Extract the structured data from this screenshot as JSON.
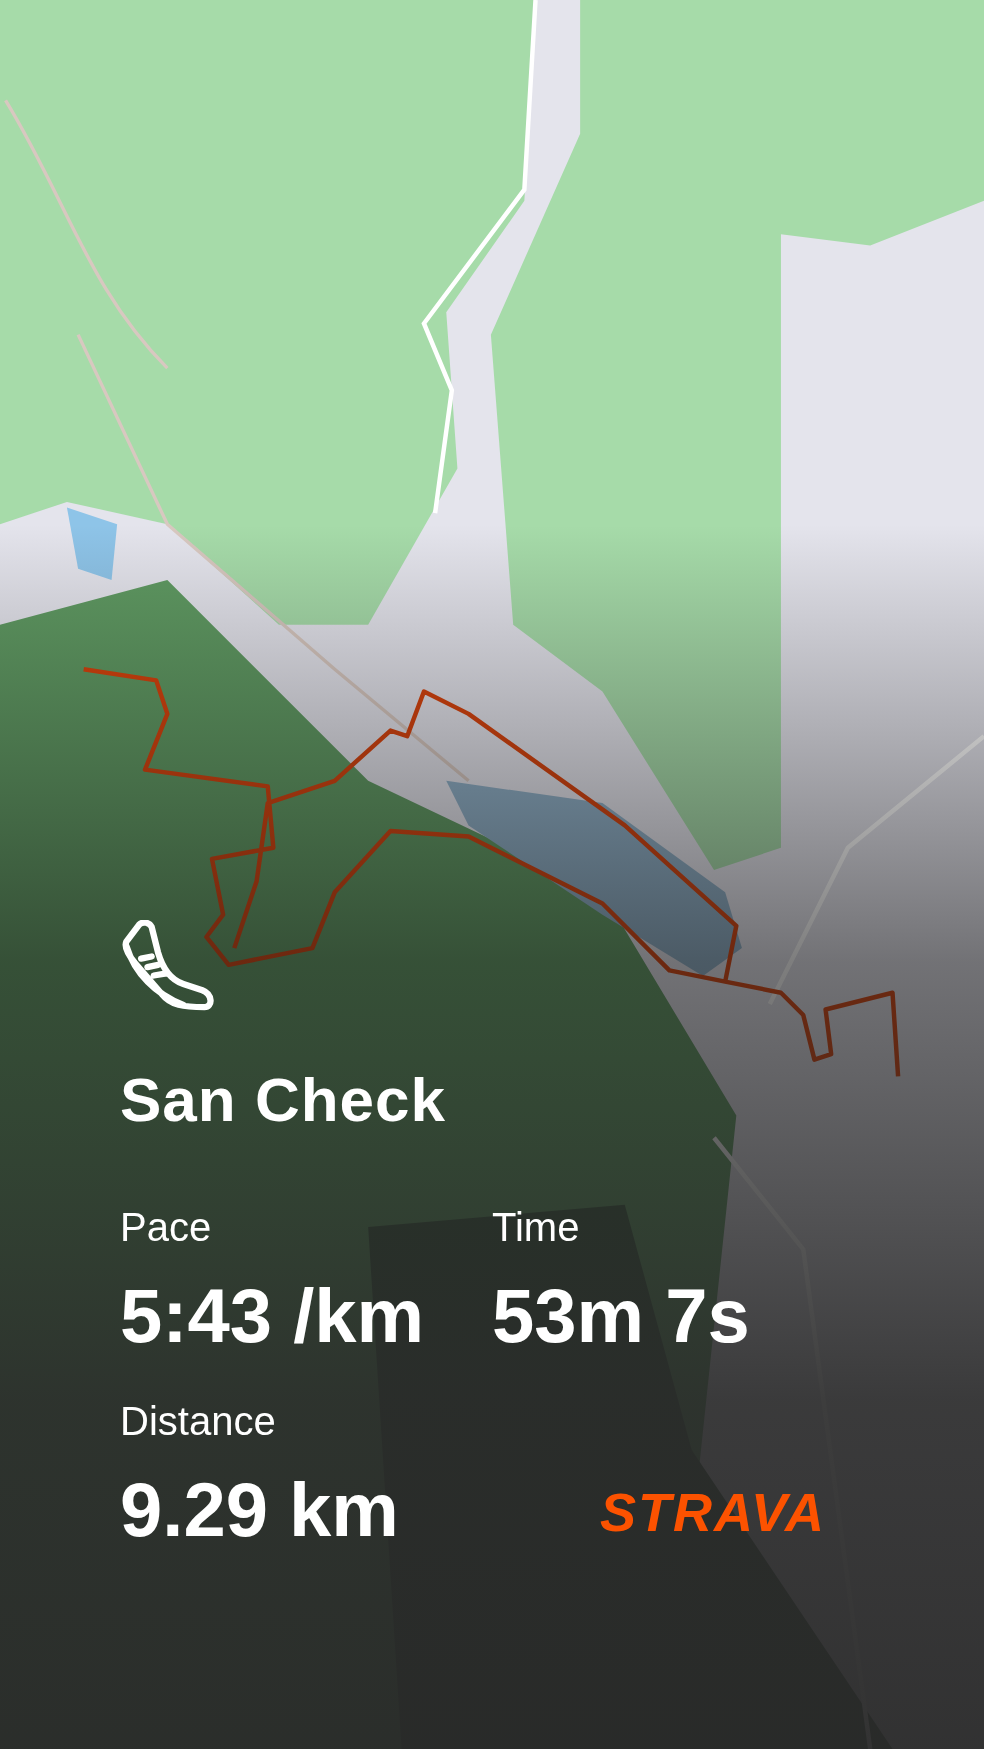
{
  "activity": {
    "title": "San Check"
  },
  "stats": [
    {
      "label": "Pace",
      "value": "5:43 /km"
    },
    {
      "label": "Time",
      "value": "53m 7s"
    },
    {
      "label": "Distance",
      "value": "9.29 km"
    }
  ],
  "brand": {
    "logo": "STRAVA"
  }
}
